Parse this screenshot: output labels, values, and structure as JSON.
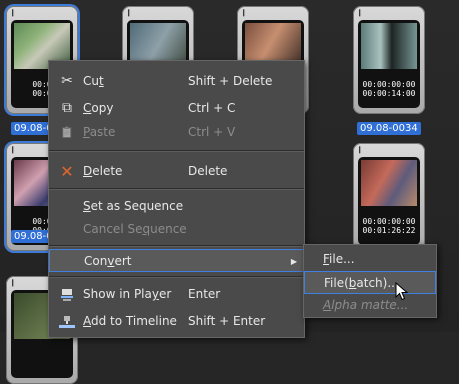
{
  "clips": [
    {
      "id": "c1",
      "timecode_in": "00:0",
      "timecode_out": "00:0",
      "label": "09.08-0",
      "selected": true
    },
    {
      "id": "c2",
      "timecode_in": "",
      "timecode_out": "",
      "label": "",
      "selected": false
    },
    {
      "id": "c3",
      "timecode_in": "",
      "timecode_out": "",
      "label": "",
      "selected": false
    },
    {
      "id": "c4",
      "timecode_in": "00:00:00:00",
      "timecode_out": "00:00:14:00",
      "label": "09.08-0034",
      "selected": true
    },
    {
      "id": "c5",
      "timecode_in": "00:0",
      "timecode_out": "00:0",
      "label": "09.08-0",
      "selected": true
    },
    {
      "id": "c6",
      "timecode_in": "00:00:00:00",
      "timecode_out": "00:01:26:22",
      "label": "",
      "selected": false
    }
  ],
  "clip_flag": "𝄃",
  "menu": {
    "items": [
      {
        "icon": "✂",
        "label_pre": "Cu",
        "label_ul": "t",
        "label_post": "",
        "shortcut": "Shift + Delete",
        "disabled": false
      },
      {
        "icon": "⧉",
        "label_pre": "",
        "label_ul": "C",
        "label_post": "opy",
        "shortcut": "Ctrl + C",
        "disabled": false
      },
      {
        "icon": "📋",
        "label_pre": "",
        "label_ul": "P",
        "label_post": "aste",
        "shortcut": "Ctrl + V",
        "disabled": true
      },
      {
        "icon": "✕",
        "label_pre": "",
        "label_ul": "D",
        "label_post": "elete",
        "shortcut": "Delete",
        "disabled": false
      },
      {
        "icon": "",
        "label_pre": "",
        "label_ul": "S",
        "label_post": "et as Sequence",
        "shortcut": "",
        "disabled": false
      },
      {
        "icon": "",
        "label_pre": "Cancel Se",
        "label_ul": "q",
        "label_post": "uence",
        "shortcut": "",
        "disabled": true
      },
      {
        "icon": "",
        "label_pre": "Con",
        "label_ul": "v",
        "label_post": "ert",
        "shortcut": "",
        "disabled": false,
        "submenu_arrow": "▶"
      },
      {
        "icon": "",
        "label_pre": "Show in Pla",
        "label_ul": "y",
        "label_post": "er",
        "shortcut": "Enter",
        "disabled": false
      },
      {
        "icon": "",
        "label_pre": "",
        "label_ul": "A",
        "label_post": "dd to Timeline",
        "shortcut": "Shift + Enter",
        "disabled": false
      }
    ]
  },
  "submenu": {
    "items": [
      {
        "label_pre": "",
        "label_ul": "F",
        "label_post": "ile...",
        "disabled": false
      },
      {
        "label_pre": "File(",
        "label_ul": "b",
        "label_post": "atch)...",
        "disabled": false
      },
      {
        "label_pre": "",
        "label_ul": "A",
        "label_post": "lpha matte...",
        "disabled": true
      }
    ]
  },
  "colors": {
    "accent": "#3d7bd9",
    "delete_icon": "#e2662a",
    "menu_bg": "#4a4a4a"
  }
}
